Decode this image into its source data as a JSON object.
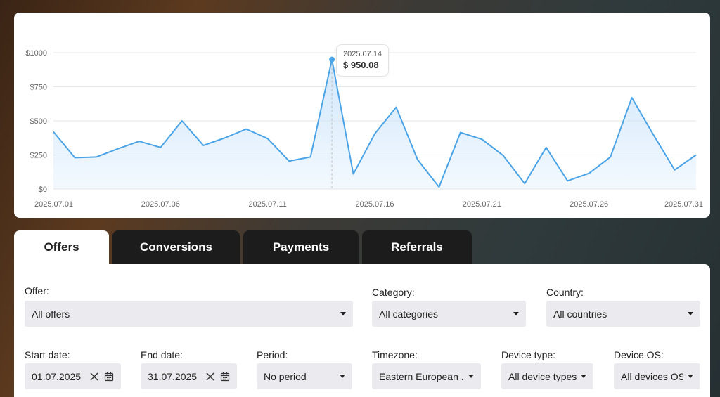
{
  "chart_data": {
    "type": "area",
    "x": [
      "2025.07.01",
      "2025.07.02",
      "2025.07.03",
      "2025.07.04",
      "2025.07.05",
      "2025.07.06",
      "2025.07.07",
      "2025.07.08",
      "2025.07.09",
      "2025.07.10",
      "2025.07.11",
      "2025.07.12",
      "2025.07.13",
      "2025.07.14",
      "2025.07.15",
      "2025.07.16",
      "2025.07.17",
      "2025.07.18",
      "2025.07.19",
      "2025.07.20",
      "2025.07.21",
      "2025.07.22",
      "2025.07.23",
      "2025.07.24",
      "2025.07.25",
      "2025.07.26",
      "2025.07.27",
      "2025.07.28",
      "2025.07.29",
      "2025.07.30",
      "2025.07.31"
    ],
    "values": [
      420,
      230,
      235,
      295,
      350,
      305,
      500,
      320,
      375,
      440,
      370,
      205,
      235,
      950.08,
      110,
      405,
      600,
      215,
      15,
      415,
      365,
      245,
      40,
      305,
      60,
      115,
      235,
      670,
      400,
      140,
      250
    ],
    "x_tick_labels": [
      "2025.07.01",
      "2025.07.06",
      "2025.07.11",
      "2025.07.16",
      "2025.07.21",
      "2025.07.26",
      "2025.07.31"
    ],
    "y_tick_labels": [
      "$0",
      "$250",
      "$500",
      "$750",
      "$1000"
    ],
    "y_ticks": [
      0,
      250,
      500,
      750,
      1000
    ],
    "ylim": [
      0,
      1000
    ],
    "grid": true,
    "line_color": "#4aa3e6",
    "fill_color": "#cfe6fb",
    "tooltip": {
      "index": 13,
      "date": "2025.07.14",
      "value": "$ 950.08"
    }
  },
  "tabs": [
    {
      "label": "Offers",
      "active": true
    },
    {
      "label": "Conversions",
      "active": false
    },
    {
      "label": "Payments",
      "active": false
    },
    {
      "label": "Referrals",
      "active": false
    }
  ],
  "filters": {
    "offer": {
      "label": "Offer:",
      "value": "All offers"
    },
    "category": {
      "label": "Category:",
      "value": "All categories"
    },
    "country": {
      "label": "Country:",
      "value": "All countries"
    },
    "start_date": {
      "label": "Start date:",
      "value": "01.07.2025"
    },
    "end_date": {
      "label": "End date:",
      "value": "31.07.2025"
    },
    "period": {
      "label": "Period:",
      "value": "No period"
    },
    "timezone": {
      "label": "Timezone:",
      "value": "Eastern European ..."
    },
    "device_type": {
      "label": "Device type:",
      "value": "All device types"
    },
    "device_os": {
      "label": "Device OS:",
      "value": "All devices OS"
    }
  },
  "icons": {
    "clear": "close-icon",
    "calendar": "calendar-icon",
    "dropdown": "chevron-down-icon"
  }
}
